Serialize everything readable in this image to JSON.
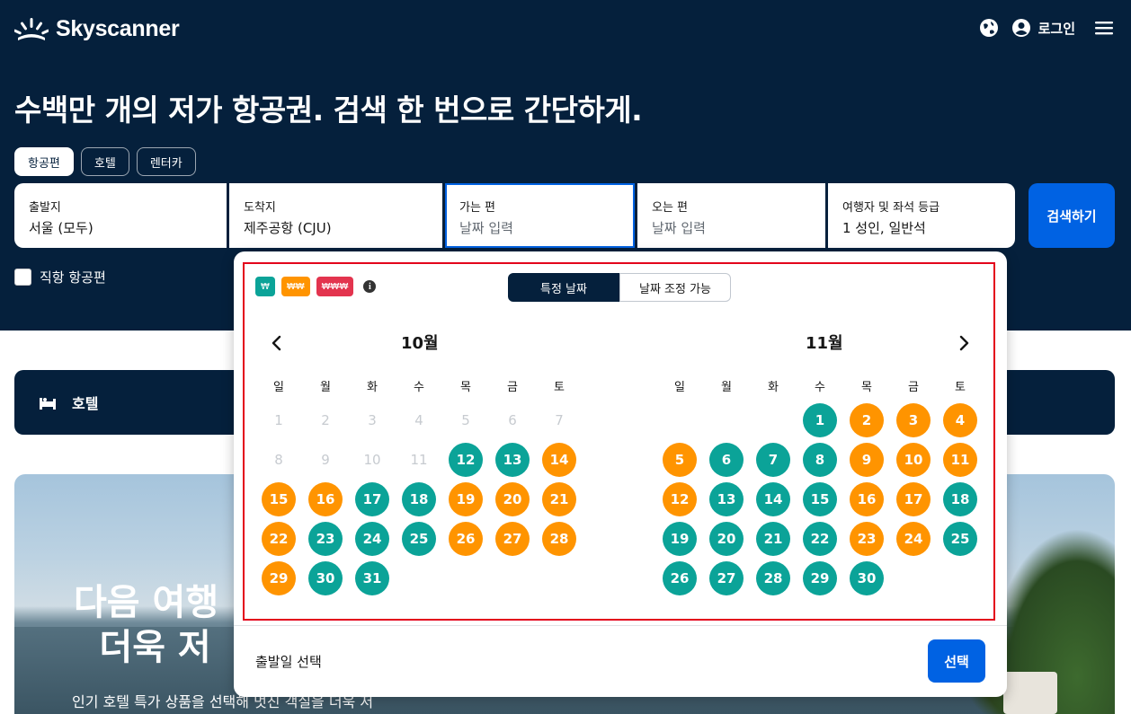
{
  "brand": {
    "name": "Skyscanner"
  },
  "header": {
    "login_label": "로그인"
  },
  "hero": {
    "headline": "수백만 개의 저가 항공권. 검색 한 번으로 간단하게."
  },
  "tabs": [
    {
      "label": "항공편"
    },
    {
      "label": "호텔"
    },
    {
      "label": "렌터카"
    }
  ],
  "search": {
    "from": {
      "label": "출발지",
      "value": "서울 (모두)"
    },
    "to": {
      "label": "도착지",
      "value": "제주공항 (CJU)"
    },
    "depart": {
      "label": "가는 편",
      "placeholder": "날짜 입력"
    },
    "return": {
      "label": "오는 편",
      "placeholder": "날짜 입력"
    },
    "travellers": {
      "label": "여행자 및 좌석 등급",
      "value": "1 성인, 일반석"
    },
    "button": "검색하기"
  },
  "direct_only": {
    "label": "직항 항공편",
    "checked": false
  },
  "hotel_bar": {
    "label": "호텔"
  },
  "promo": {
    "title_line1": "다음 여행",
    "title_line2": "더욱 저",
    "subtitle": "인기 호텔 특가 상품을 선택해 멋진 객실을 더욱 저"
  },
  "calendar": {
    "price_badges": [
      {
        "label": "₩",
        "color": "#0ba398"
      },
      {
        "label": "₩₩",
        "color": "#ff9400"
      },
      {
        "label": "₩₩₩",
        "color": "#e3344e"
      }
    ],
    "modes": {
      "specific": "특정 날짜",
      "flexible": "날짜 조정 가능"
    },
    "weekdays": [
      "일",
      "월",
      "화",
      "수",
      "목",
      "금",
      "토"
    ],
    "months": [
      {
        "title": "10월",
        "weeks": [
          [
            [
              "1",
              "d"
            ],
            [
              "2",
              "d"
            ],
            [
              "3",
              "d"
            ],
            [
              "4",
              "d"
            ],
            [
              "5",
              "d"
            ],
            [
              "6",
              "d"
            ],
            [
              "7",
              "d"
            ]
          ],
          [
            [
              "8",
              "d"
            ],
            [
              "9",
              "d"
            ],
            [
              "10",
              "d"
            ],
            [
              "11",
              "d"
            ],
            [
              "12",
              "g"
            ],
            [
              "13",
              "g"
            ],
            [
              "14",
              "o"
            ]
          ],
          [
            [
              "15",
              "o"
            ],
            [
              "16",
              "o"
            ],
            [
              "17",
              "g"
            ],
            [
              "18",
              "g"
            ],
            [
              "19",
              "o"
            ],
            [
              "20",
              "o"
            ],
            [
              "21",
              "o"
            ]
          ],
          [
            [
              "22",
              "o"
            ],
            [
              "23",
              "g"
            ],
            [
              "24",
              "g"
            ],
            [
              "25",
              "g"
            ],
            [
              "26",
              "o"
            ],
            [
              "27",
              "o"
            ],
            [
              "28",
              "o"
            ]
          ],
          [
            [
              "29",
              "o"
            ],
            [
              "30",
              "g"
            ],
            [
              "31",
              "g"
            ],
            [
              "",
              "e"
            ],
            [
              "",
              "e"
            ],
            [
              "",
              "e"
            ],
            [
              "",
              "e"
            ]
          ]
        ]
      },
      {
        "title": "11월",
        "weeks": [
          [
            [
              "",
              "e"
            ],
            [
              "",
              "e"
            ],
            [
              "",
              "e"
            ],
            [
              "1",
              "g"
            ],
            [
              "2",
              "o"
            ],
            [
              "3",
              "o"
            ],
            [
              "4",
              "o"
            ]
          ],
          [
            [
              "5",
              "o"
            ],
            [
              "6",
              "g"
            ],
            [
              "7",
              "g"
            ],
            [
              "8",
              "g"
            ],
            [
              "9",
              "o"
            ],
            [
              "10",
              "o"
            ],
            [
              "11",
              "o"
            ]
          ],
          [
            [
              "12",
              "o"
            ],
            [
              "13",
              "g"
            ],
            [
              "14",
              "g"
            ],
            [
              "15",
              "g"
            ],
            [
              "16",
              "o"
            ],
            [
              "17",
              "o"
            ],
            [
              "18",
              "g"
            ]
          ],
          [
            [
              "19",
              "g"
            ],
            [
              "20",
              "g"
            ],
            [
              "21",
              "g"
            ],
            [
              "22",
              "g"
            ],
            [
              "23",
              "o"
            ],
            [
              "24",
              "o"
            ],
            [
              "25",
              "g"
            ]
          ],
          [
            [
              "26",
              "g"
            ],
            [
              "27",
              "g"
            ],
            [
              "28",
              "g"
            ],
            [
              "29",
              "g"
            ],
            [
              "30",
              "g"
            ],
            [
              "",
              "e"
            ],
            [
              "",
              "e"
            ]
          ]
        ]
      }
    ],
    "footer_text": "출발일 선택",
    "select_button": "선택"
  }
}
